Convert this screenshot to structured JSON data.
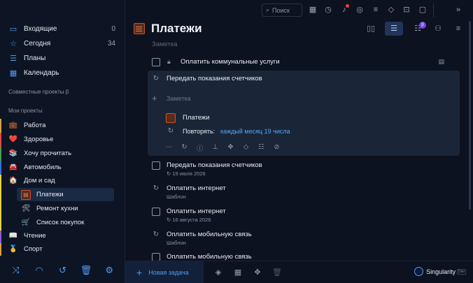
{
  "sidebar": {
    "nav": [
      {
        "label": "Входящие",
        "count": "0",
        "icon": "inbox-icon"
      },
      {
        "label": "Сегодня",
        "count": "34",
        "icon": "star-icon"
      },
      {
        "label": "Планы",
        "count": "",
        "icon": "plans-icon"
      },
      {
        "label": "Календарь",
        "count": "",
        "icon": "calendar-icon"
      }
    ],
    "shared_title": "Совместные проекты β",
    "my_title": "Мои проекты",
    "projects": [
      {
        "label": "Работа",
        "emoji": "💼"
      },
      {
        "label": "Здоровье",
        "emoji": "❤️"
      },
      {
        "label": "Хочу прочитать",
        "emoji": "📚"
      },
      {
        "label": "Автомобиль",
        "emoji": "🚘"
      },
      {
        "label": "Дом и сад",
        "emoji": "🏠"
      },
      {
        "label": "Платежи",
        "emoji": "▤"
      },
      {
        "label": "Ремонт кухни",
        "emoji": "🛠"
      },
      {
        "label": "Список покупок",
        "emoji": "🛒"
      },
      {
        "label": "Чтение",
        "emoji": "📖"
      },
      {
        "label": "Спорт",
        "emoji": "🥇"
      }
    ],
    "bottom_icons": [
      "shuffle-icon",
      "rainbow-icon",
      "history-icon",
      "trash-icon",
      "settings-icon"
    ]
  },
  "topbar": {
    "search_placeholder": "Поиск"
  },
  "header": {
    "title": "Платежи",
    "note_placeholder": "Заметка"
  },
  "tasks": {
    "t1": {
      "title": "Оплатить коммунальные услуги"
    },
    "edit": {
      "title": "Передать показания счетчиков",
      "note_placeholder": "Заметка",
      "project": "Платежи",
      "repeat_label": "Повторять:",
      "repeat_value": "каждый месяц 19 числа"
    },
    "t3": {
      "title": "Передать показания счетчиков",
      "sub": "19 июля 2026"
    },
    "t4": {
      "title": "Оплатить интернет",
      "sub": "Шаблон"
    },
    "t5": {
      "title": "Оплатить интернет",
      "sub": "16 августа 2026"
    },
    "t6": {
      "title": "Оплатить мобильную связь",
      "sub": "Шаблон"
    },
    "t7": {
      "title": "Оплатить мобильную связь"
    }
  },
  "bottombar": {
    "new_task": "Новая задача",
    "brand": "Singularity",
    "brand_tag": "Dev"
  },
  "colors": {
    "accent": "#4f9df0",
    "background": "#0c1220",
    "card": "#1a2638",
    "selected": "#1b2a44"
  }
}
